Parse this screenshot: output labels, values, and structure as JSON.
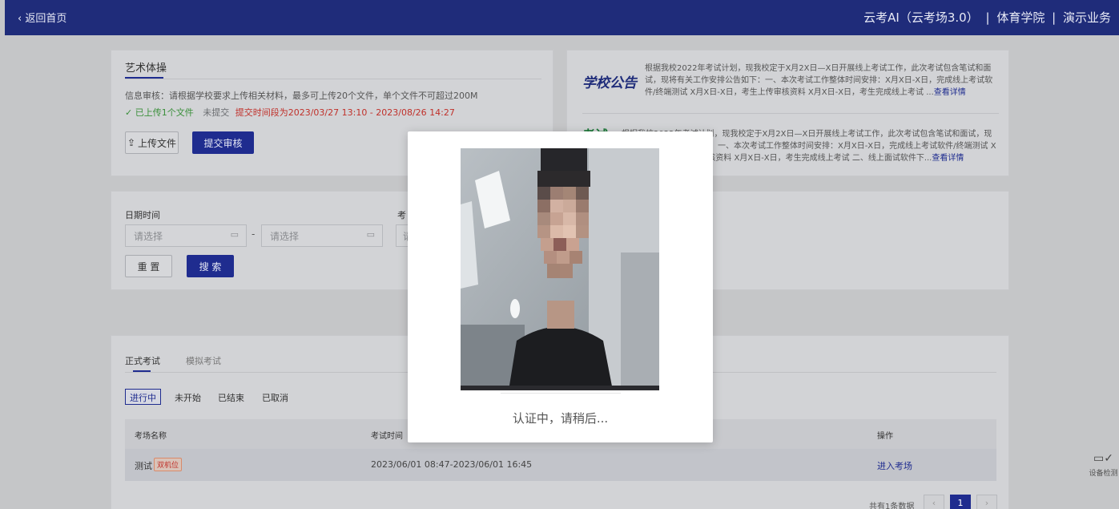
{
  "topbar": {
    "back_label": "返回首页",
    "title": "云考AI（云考场3.0）",
    "org": "体育学院",
    "biz": "演示业务",
    "sep": "|"
  },
  "upload_card": {
    "title": "艺术体操",
    "info": "信息审核：请根据学校要求上传相关材料，最多可上传20个文件，单个文件不可超过200M",
    "uploaded": "已上传1个文件",
    "not_submitted": "未提交",
    "deadline": "提交时间段为2023/03/27 13:10 - 2023/08/26 14:27",
    "upload_btn": "上传文件",
    "submit_btn": "提交审核"
  },
  "notices": [
    {
      "tag": "学校公告",
      "text": "根据我校2022年考试计划，现我校定于X月2X日—X日开展线上考试工作，此次考试包含笔试和面试，现将有关工作安排公告如下：一、本次考试工作整体时间安排：X月X日-X日，完成线上考试软件/终端测试 X月X日-X日，考生上传审核资料 X月X日-X日，考生完成线上考试 ...",
      "more": "查看详情"
    },
    {
      "tag": "考试",
      "text": "根据我校2022年考试计划，现我校定于X月2X日—X日开展线上考试工作，此次考试包含笔试和面试，现将有关工作安排公告如下：一、本次考试工作整体时间安排：X月X日-X日，完成线上考试软件/终端测试 X月X日-X日，考生上传审核资料 X月X日-X日，考生完成线上考试 二、线上面试软件下...",
      "more": "查看详情"
    }
  ],
  "filter": {
    "date_label": "日期时间",
    "exam_label": "考",
    "start_placeholder": "请选择",
    "end_placeholder": "请选择",
    "dash": "-",
    "exam_placeholder": "请",
    "reset_btn": "重 置",
    "search_btn": "搜 索"
  },
  "exams": {
    "tabs": [
      "正式考试",
      "模拟考试"
    ],
    "status_tabs": [
      "进行中",
      "未开始",
      "已结束",
      "已取消"
    ],
    "columns": [
      "考场名称",
      "考试时间",
      "操作"
    ],
    "rows": [
      {
        "name": "测试",
        "badge": "双机位",
        "time": "2023/06/01 08:47-2023/06/01 16:45",
        "action": "进入考场"
      }
    ],
    "total": "共有1条数据",
    "page": "1"
  },
  "modal": {
    "caption": "认证中，请稍后..."
  },
  "side": {
    "device_label": "设备检测"
  },
  "colors": {
    "brand": "#1f2c7a",
    "primary": "#1f2c8f",
    "danger": "#c0302a",
    "success": "#3a8f3a"
  }
}
